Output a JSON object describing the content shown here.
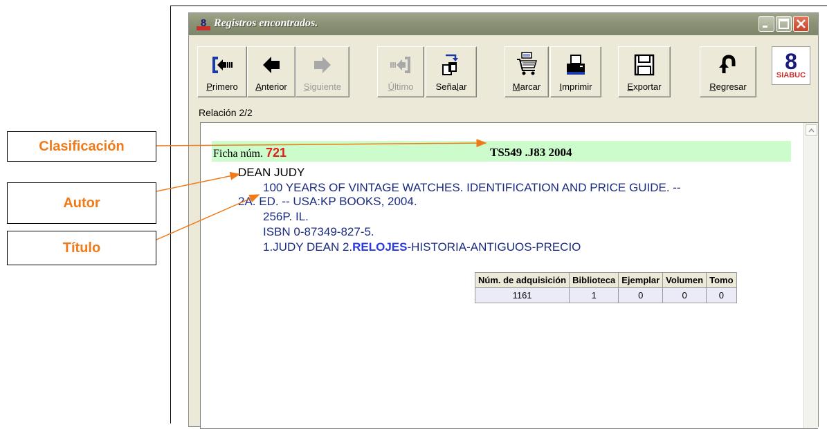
{
  "callouts": {
    "clasificacion": "Clasificación",
    "autor": "Autor",
    "titulo": "Título"
  },
  "window": {
    "title": "Registros encontrados."
  },
  "toolbar": [
    {
      "name": "primero",
      "label": "Primero",
      "icon": "first-record-icon",
      "enabled": true
    },
    {
      "name": "anterior",
      "label": "Anterior",
      "icon": "arrow-left-icon",
      "enabled": true
    },
    {
      "name": "siguiente",
      "label": "Siguiente",
      "icon": "arrow-right-icon",
      "enabled": false
    },
    {
      "name": "ultimo",
      "label": "Último",
      "icon": "last-record-icon",
      "enabled": false
    },
    {
      "name": "senalar",
      "label": "Señalar",
      "icon": "mark-pages-icon",
      "enabled": true
    },
    {
      "name": "marcar",
      "label": "Marcar",
      "icon": "cart-book-icon",
      "enabled": true
    },
    {
      "name": "imprimir",
      "label": "Imprimir",
      "icon": "printer-icon",
      "enabled": true
    },
    {
      "name": "exportar",
      "label": "Exportar",
      "icon": "floppy-disk-icon",
      "enabled": true
    },
    {
      "name": "regresar",
      "label": "Regresar",
      "icon": "return-arrow-icon",
      "enabled": true
    }
  ],
  "logo_text": "SIABUC",
  "relacion": {
    "label": "Relación",
    "value": "2/2"
  },
  "record": {
    "ficha_label": "Ficha núm.",
    "ficha_num": "721",
    "clasificacion": "TS549 .J83 2004",
    "autor": "DEAN JUDY",
    "titulo_line1": "100 YEARS OF VINTAGE WATCHES. IDENTIFICATION AND PRICE GUIDE. --",
    "titulo_line2": "2A. ED. -- USA:KP BOOKS, 2004.",
    "paginas": "256P. IL.",
    "isbn": "ISBN 0-87349-827-5.",
    "materia_pre": "1.JUDY DEAN 2.",
    "materia_bold": "RELOJES",
    "materia_post": "-HISTORIA-ANTIGUOS-PRECIO"
  },
  "table": {
    "headers": [
      "Núm. de adquisición",
      "Biblioteca",
      "Ejemplar",
      "Volumen",
      "Tomo"
    ],
    "rows": [
      [
        "1161",
        "1",
        "0",
        "0",
        "0"
      ]
    ]
  },
  "colors": {
    "callout_text": "#f07a17",
    "arrow": "#f07a17",
    "ficha_bar": "#ccfccc",
    "ficha_num": "#e0201a",
    "record_text": "#1a2b80"
  }
}
